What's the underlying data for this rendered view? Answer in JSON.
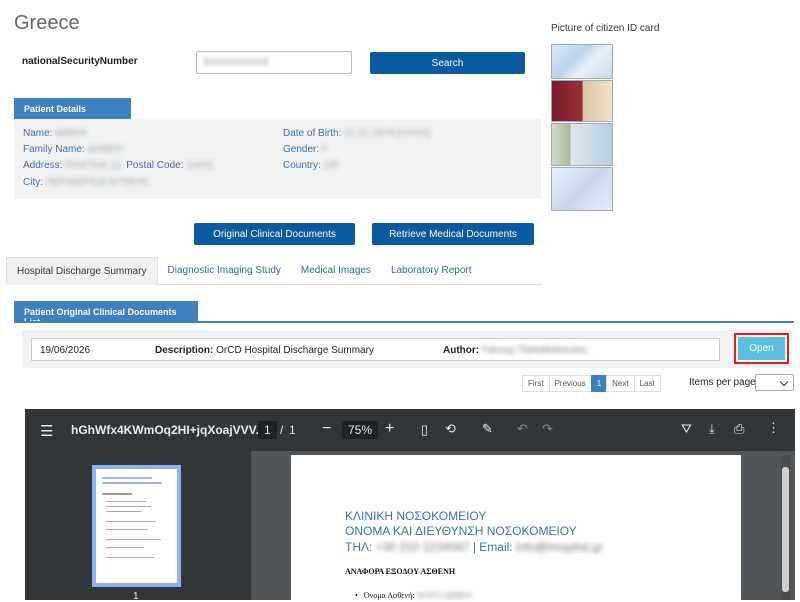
{
  "country": "Greece",
  "search": {
    "label": "nationalSecurityNumber",
    "value": "XXXXXXXXXXX",
    "button": "Search"
  },
  "patient": {
    "section": "Patient Details",
    "name_label": "Name:",
    "name_value": "MARIA",
    "family_label": "Family Name:",
    "family_value": "ΔΗΜΟΥ",
    "address_label": "Address:",
    "address_value": "ΠΛΑΤΕΙΑ 12,",
    "postal_label": "Postal Code:",
    "postal_value": "10431",
    "city_label": "City:",
    "city_value": "ΠΕΡΙΦΕΡΕΙΑ ΑΤΤΙΚΗΣ",
    "dob_label": "Date of Birth:",
    "dob_value": "01.01.1975 (ΧΧΧΧ)",
    "gender_label": "Gender:",
    "gender_value": "F",
    "country_label": "Country:",
    "country_value": "GR"
  },
  "actions": {
    "original": "Original Clinical Documents",
    "retrieve": "Retrieve Medical Documents"
  },
  "tabs": [
    "Hospital Discharge Summary",
    "Diagnostic Imaging Study",
    "Medical Images",
    "Laboratory Report"
  ],
  "list": {
    "section": "Patient Original Clinical Documents List",
    "date": "19/06/2026",
    "description_label": "Description:",
    "description_value": "OrCD Hospital Discharge Summary",
    "author_label": "Author:",
    "author_value": "Γιάννης Παπαδόπουλος",
    "open": "Open"
  },
  "pager": {
    "first": "First",
    "previous": "Previous",
    "current": "1",
    "next": "Next",
    "last": "Last",
    "items_label": "Items per page:"
  },
  "id_card_label": "Picture of citizen ID card",
  "pdf": {
    "title": "hGhWfx4KWmOq2HI+jqXoajVVV...",
    "page_current": "1",
    "page_sep": "/",
    "page_total": "1",
    "zoom": "75%",
    "thumb_page": "1",
    "line1": "ΚΛΙΝΙΚΗ ΝΟΣΟΚΟΜΕΙΟΥ",
    "line2": "ΟΝΟΜΑ ΚΑΙ ΔΙΕΥΘΥΝΣΗ ΝΟΣΟΚΟΜΕΙΟΥ",
    "tel_label": "ΤΗΛ:",
    "tel_value": "+30 210 1234567",
    "email_sep": "| Email:",
    "email_value": "info@hospital.gr",
    "heading": "ΑΝΑΦΟΡΑ ΕΞΟΔΟΥ ΑΣΘΕΝΗ",
    "bullet_label": "Όνομα Ασθενή:",
    "bullet_value": "ΜΑΡΙΑ ΔΗΜΟΥ"
  }
}
